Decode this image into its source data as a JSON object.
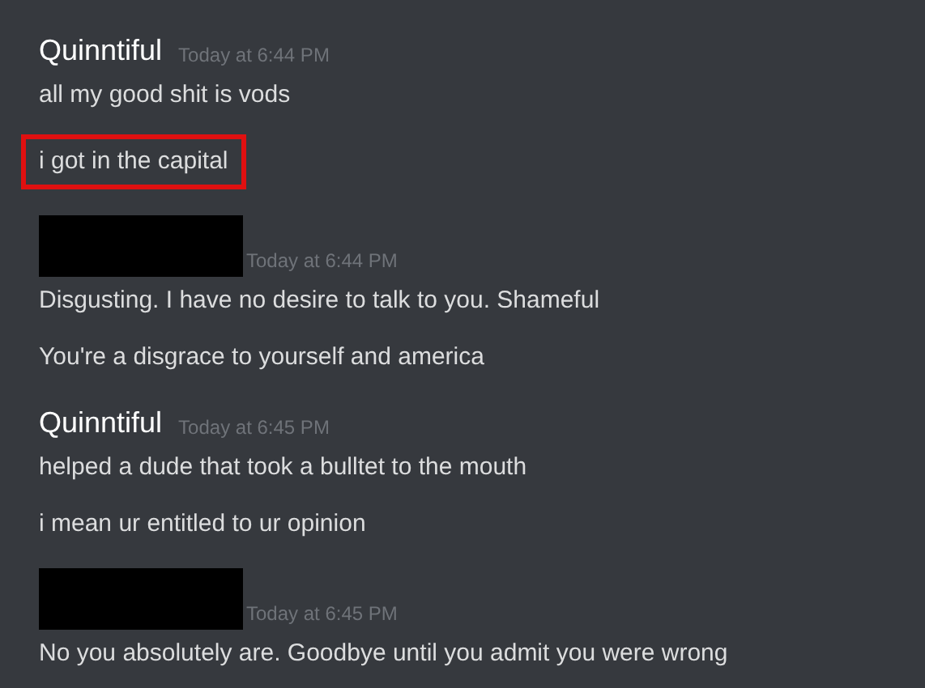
{
  "messages": [
    {
      "author": "Quinntiful",
      "redacted": false,
      "timestamp": "Today at 6:44 PM",
      "lines": [
        {
          "text": "all my good shit is vods",
          "highlighted": false
        },
        {
          "text": "i got in the capital",
          "highlighted": true
        }
      ]
    },
    {
      "redacted": true,
      "timestamp": "Today at 6:44 PM",
      "lines": [
        {
          "text": "Disgusting. I have no desire to talk to you. Shameful",
          "highlighted": false
        },
        {
          "text": "You're a disgrace to yourself and america",
          "highlighted": false
        }
      ]
    },
    {
      "author": "Quinntiful",
      "redacted": false,
      "timestamp": "Today at 6:45 PM",
      "lines": [
        {
          "text": "helped a dude that took a bulltet to the mouth",
          "highlighted": false
        },
        {
          "text": "i mean ur entitled to ur opinion",
          "highlighted": false
        }
      ]
    },
    {
      "redacted": true,
      "timestamp": "Today at 6:45 PM",
      "lines": [
        {
          "text": "No you absolutely are. Goodbye until you admit you were wrong",
          "highlighted": false
        }
      ]
    }
  ]
}
